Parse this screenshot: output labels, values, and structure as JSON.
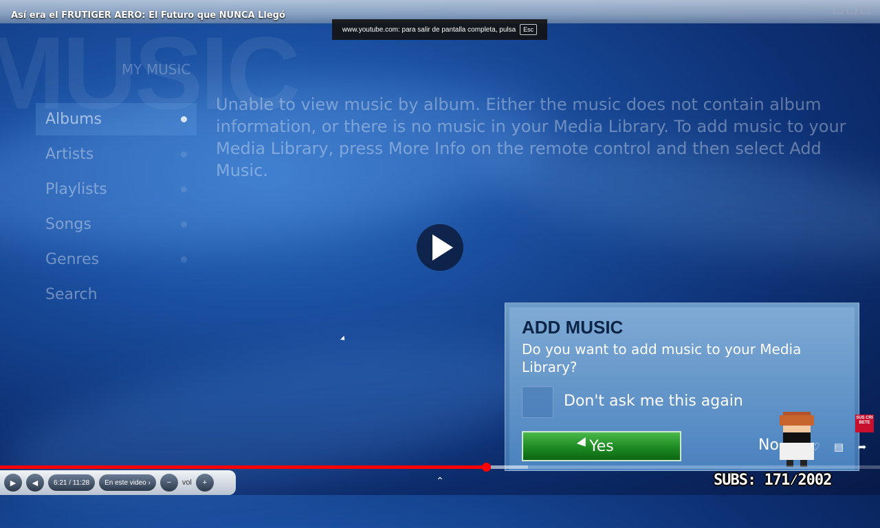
{
  "window": {
    "title": "Así era el FRUTIGER AERO: El Futuro que NUNCA Llegó"
  },
  "fullscreen_toast": {
    "text": "www.youtube.com: para salir de pantalla completa, pulsa",
    "key": "Esc"
  },
  "media_center": {
    "watermark": "MUSIC",
    "section": "MY MUSIC",
    "menu": [
      {
        "label": "Albums",
        "selected": true
      },
      {
        "label": "Artists",
        "selected": false
      },
      {
        "label": "Playlists",
        "selected": false
      },
      {
        "label": "Songs",
        "selected": false
      },
      {
        "label": "Genres",
        "selected": false
      },
      {
        "label": "Search",
        "selected": false
      }
    ],
    "message": "Unable to view music by album. Either the music does not contain album information, or there is no music in your Media Library. To add music to your Media Library, press More Info on the remote control and then select Add Music."
  },
  "dialog": {
    "title": "ADD MUSIC",
    "question": "Do you want to add music to your Media Library?",
    "checkbox_label": "Don't ask me this again",
    "yes_label": "Yes",
    "no_label": "No"
  },
  "overlay": {
    "subscribe_badge": "SUS CRI BETE",
    "subs_counter": "SUBS: 171⁄2002"
  },
  "player": {
    "time": "6:21 / 11:28",
    "chapter": "En este video",
    "volume_label": "vol",
    "progress_fraction": 0.552,
    "buffer_fraction": 0.6,
    "accent_color": "#ff0000"
  }
}
